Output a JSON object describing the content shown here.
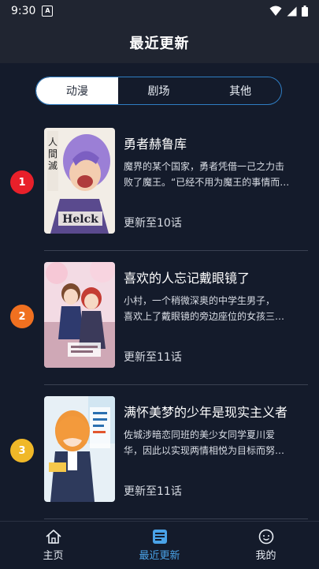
{
  "status_bar": {
    "time": "9:30",
    "icons": [
      "a-notification-icon",
      "wifi-icon",
      "signal-icon",
      "battery-icon"
    ]
  },
  "header": {
    "title": "最近更新"
  },
  "segment": {
    "tabs": [
      "动漫",
      "剧场",
      "其他"
    ],
    "active_index": 0
  },
  "colors": {
    "accent": "#2f7dc2",
    "tab_active": "#4aa3e8",
    "background": "#141b2b",
    "rank1": "#e8202a",
    "rank2": "#f07020",
    "rank3": "#f0b828"
  },
  "items": [
    {
      "rank": "1",
      "title": "勇者赫鲁库",
      "desc_line1": "魔界的某个国家，勇者凭借一己之力击",
      "desc_line2": "败了魔王。“已经不用为魔王的事情而…",
      "update": "更新至10话",
      "cover_text": "Helck"
    },
    {
      "rank": "2",
      "title": "喜欢的人忘记戴眼镜了",
      "desc_line1": "小村，一个稍微深奥的中学生男子，",
      "desc_line2": "喜欢上了戴眼镜的旁边座位的女孩三…",
      "update": "更新至11话",
      "cover_text": ""
    },
    {
      "rank": "3",
      "title": "满怀美梦的少年是现实主义者",
      "desc_line1": "佐城涉暗恋同班的美少女同学夏川爱",
      "desc_line2": "华，因此以实现两情相悦为目标而努…",
      "update": "更新至11话",
      "cover_text": ""
    }
  ],
  "tabbar": {
    "items": [
      "主页",
      "最近更新",
      "我的"
    ],
    "active_index": 1
  }
}
